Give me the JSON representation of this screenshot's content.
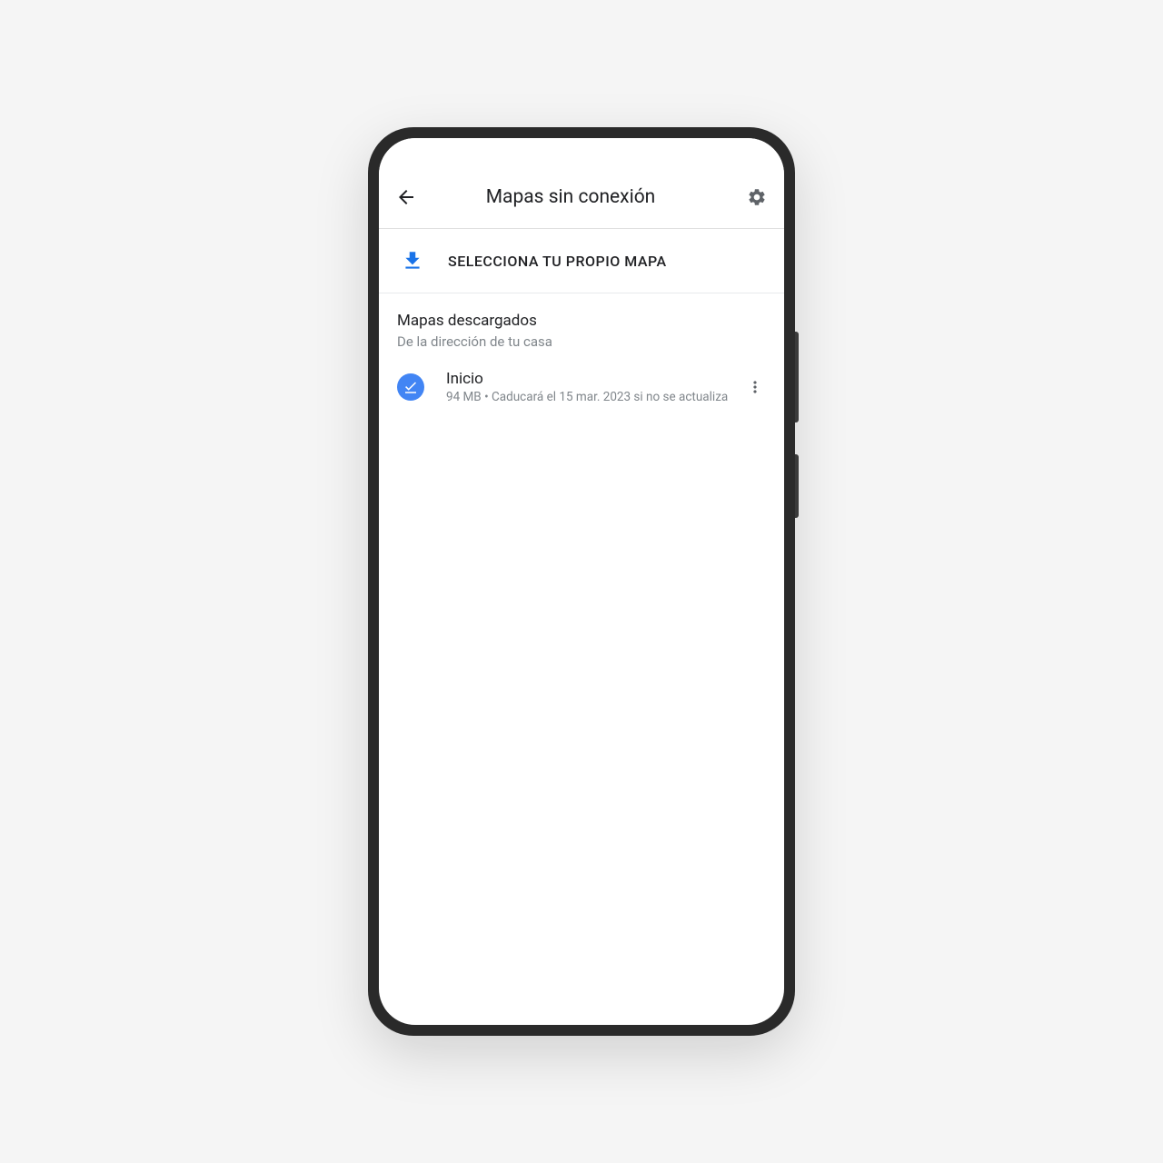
{
  "header": {
    "title": "Mapas sin conexión"
  },
  "select_map": {
    "label": "SELECCIONA TU PROPIO MAPA"
  },
  "downloaded_section": {
    "title": "Mapas descargados",
    "subtitle": "De la dirección de tu casa"
  },
  "maps": [
    {
      "name": "Inicio",
      "details": "94 MB • Caducará el 15 mar. 2023 si no se actualiza"
    }
  ]
}
